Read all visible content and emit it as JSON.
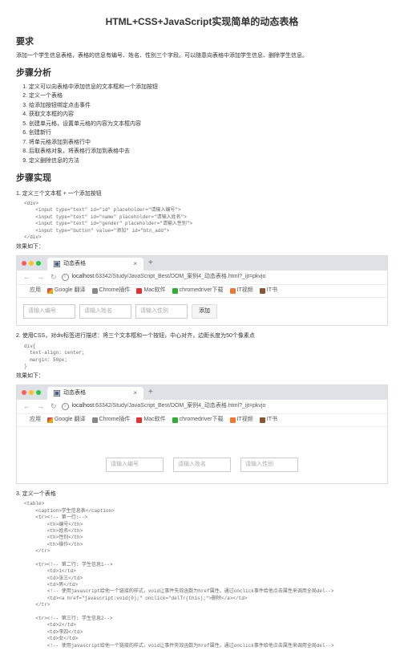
{
  "title": "HTML+CSS+JavaScript实现简单的动态表格",
  "h_req": "要求",
  "req_desc": "添加一个学生信息表格，表格的信息有编号、姓名、性别三个字段。可以随意向表格中添加学生信息、删除学生信息。",
  "h_analysis": "步骤分析",
  "steps": [
    "定义可以向表格中添加信息的文本框和一个添加按钮",
    "定义一个表格",
    "给添加按钮绑定点击事件",
    "获取文本框的内容",
    "创建单元格，设置单元格的内容为文本框内容",
    "创建新行",
    "将单元格添加到表格行中",
    "后取表格对象，将表格行添加到表格中去",
    "定义删除信息的方法"
  ],
  "h_impl": "步骤实现",
  "s1": {
    "num": "1.",
    "title": "定义三个文本框 + 一个添加按钮",
    "code": "<div>\n    <input type=\"text\" id=\"id\" placeholder=\"请输入编号\">\n    <input type=\"text\" id=\"name\" placeholder=\"请输入姓名\">\n    <input type=\"text\" id=\"gender\" placeholder=\"请输入性别\">\n    <input type=\"button\" value=\"添加\" id=\"btn_add\">\n</div>",
    "cap": "效果如下："
  },
  "s2": {
    "num": "2.",
    "title": "使用CSS，对div标签进行描述：将三个文本框和一个按钮，中心对齐，边距长度为50个像素点",
    "code": "div{\n  text-align: center;\n  margin: 50px;\n}",
    "cap": "效果如下："
  },
  "s3": {
    "num": "3.",
    "title": "定义一个表格",
    "code": "<table>\n    <caption>学生信息表</caption>\n    <tr><!-- 第一行:-->\n        <th>编号</th>\n        <th>姓名</th>\n        <th>性别</th>\n        <th>操作</th>\n    </tr>\n\n    <tr><!-- 第二行: 学生信息1-->\n        <td>1</td>\n        <td>张三</td>\n        <td>男</td>\n        <!-- 使用javascript给他一个链接的样式，void让事件失效函数为href属性。通过onclick事件给他点击属性来调用全局del-->\n        <td><a href=\"javascript:void(0);\" onclick=\"delTr(this);\">删除</a></td>\n    </tr>\n\n    <tr><!-- 第三行: 学生信息2-->\n        <td>2</td>\n        <td>李四</td>\n        <td>女</td>\n        <!-- 使用javascript给他一个链接的样式，void让事件失效函数为href属性。通过onclick事件给他点击属性来调用全局del-->"
  },
  "browser": {
    "tab_title": "动态表格",
    "url_host": "localhost",
    "url_path": ":63342/Study/JavaScript_Best/DOM_案例4_动态表格.html?_ijt=pkvjo",
    "bm_apps": "应用",
    "bm_g": "Google 翻译",
    "bm_chrome": "Chrome插件",
    "bm_mac": "Mac软件",
    "bm_cd": "chromedriver下载",
    "bm_it": "IT视频",
    "bm_it2": "IT书"
  },
  "form": {
    "ph_id": "请输入编号",
    "ph_name": "请输入姓名",
    "ph_gender": "请输入性别",
    "btn_add": "添加"
  }
}
